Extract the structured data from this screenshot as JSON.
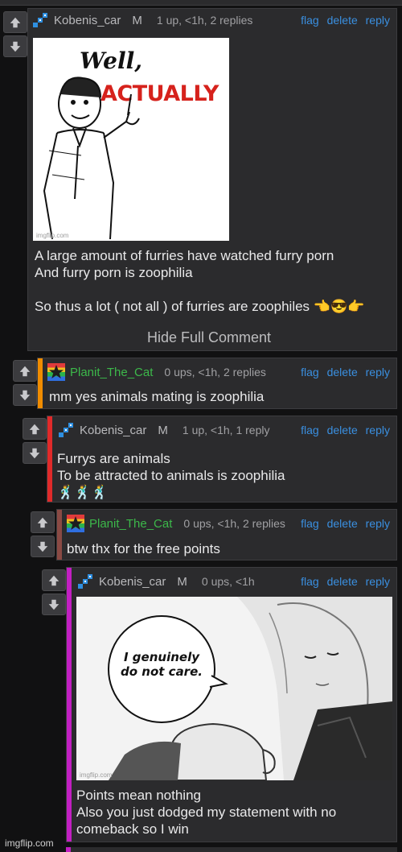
{
  "comments": [
    {
      "username": "Kobenis_car",
      "badge": "M",
      "meta": "1 up, <1h, 2 replies",
      "actions": [
        "flag",
        "delete",
        "reply"
      ],
      "meme_text": {
        "line1": "Well,",
        "line2": "ACTUALLY"
      },
      "meme_credit": "imgflip.com",
      "text": "A large amount of furries have watched furry porn\nAnd furry porn is zoophilia\n\nSo thus a lot ( not all ) of furries are zoophiles 👈😎👉",
      "hide_label": "Hide Full Comment"
    },
    {
      "username": "Planit_The_Cat",
      "meta": "0 ups, <1h, 2 replies",
      "actions": [
        "flag",
        "delete",
        "reply"
      ],
      "text": "mm yes animals mating is zoophilia",
      "accent": "#f08c00"
    },
    {
      "username": "Kobenis_car",
      "badge": "M",
      "meta": "1 up, <1h, 1 reply",
      "actions": [
        "flag",
        "delete",
        "reply"
      ],
      "text": "Furrys are animals\nTo be attracted to animals is zoophilia\n🕺🕺🕺",
      "accent": "#e02a2a"
    },
    {
      "username": "Planit_The_Cat",
      "meta": "0 ups, <1h, 2 replies",
      "actions": [
        "flag",
        "delete",
        "reply"
      ],
      "text": "btw thx for the free points",
      "accent": "#8a4a44"
    },
    {
      "username": "Kobenis_car",
      "badge": "M",
      "meta": "0 ups, <1h",
      "actions": [
        "flag",
        "delete",
        "reply"
      ],
      "meme_text": {
        "speech": "I genuinely\ndo not care."
      },
      "meme_credit": "imgflip.com",
      "text": "Points mean nothing\nAlso you just dodged my statement with no\ncomeback so I win",
      "accent": "#c21fc2"
    }
  ],
  "watermark": "imgflip.com",
  "colors": {
    "link": "#3a8fe0",
    "green_name": "#3cb84a"
  },
  "icons": {
    "up": "up-arrow-icon",
    "down": "down-arrow-icon",
    "user_k": "diagonal-pixel-icon",
    "user_p": "rainbow-star-icon"
  }
}
